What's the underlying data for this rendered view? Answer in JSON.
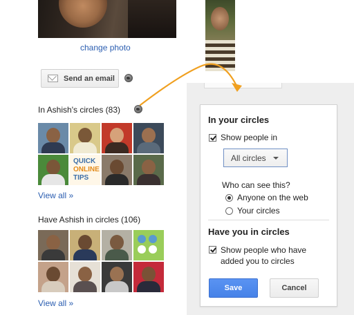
{
  "profile": {
    "change_photo": "change photo",
    "send_email": "Send an email",
    "in_circles_title": "In Ashish's circles (83)",
    "have_in_circles_title": "Have Ashish in circles (106)",
    "view_all": "View all »",
    "logo_tile": [
      "QUICK",
      "ONLINE",
      "TIPS"
    ]
  },
  "settings": {
    "in_your_circles": "In your circles",
    "show_people_in": "Show people in",
    "show_people_in_checked": true,
    "circles_select": "All circles",
    "who_can_see": "Who can see this?",
    "option_web": "Anyone on the web",
    "option_circles": "Your circles",
    "selected_option": "Anyone on the web",
    "have_you_in_circles": "Have you in circles",
    "show_added_line1": "Show people who have",
    "show_added_line2": "added you to circles",
    "show_added_checked": true,
    "save": "Save",
    "cancel": "Cancel"
  },
  "colors": {
    "link": "#2a5db0",
    "save_button": "#4682e8",
    "connector_arrow": "#f0a020",
    "panel_background": "#eeeeee"
  }
}
